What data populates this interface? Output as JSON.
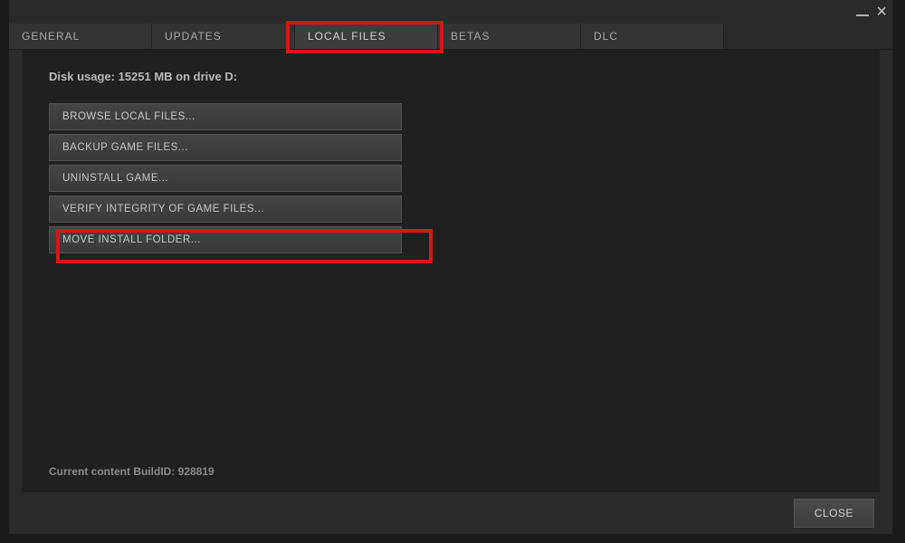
{
  "tabs": {
    "general": "GENERAL",
    "updates": "UPDATES",
    "local_files": "LOCAL FILES",
    "betas": "BETAS",
    "dlc": "DLC"
  },
  "content": {
    "disk_usage": "Disk usage: 15251 MB on drive D:",
    "buttons": {
      "browse": "BROWSE LOCAL FILES...",
      "backup": "BACKUP GAME FILES...",
      "uninstall": "UNINSTALL GAME...",
      "verify": "VERIFY INTEGRITY OF GAME FILES...",
      "move": "MOVE INSTALL FOLDER..."
    },
    "build_id": "Current content BuildID: 928819"
  },
  "footer": {
    "close": "CLOSE"
  }
}
